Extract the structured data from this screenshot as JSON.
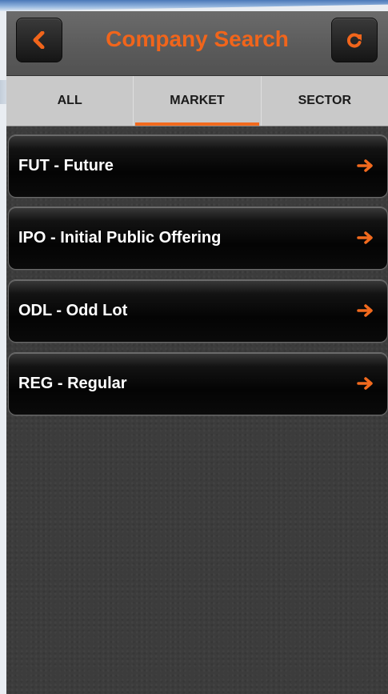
{
  "header": {
    "title": "Company Search",
    "back_icon": "chevron-left-icon",
    "refresh_icon": "refresh-icon"
  },
  "tabs": [
    {
      "label": "ALL",
      "active": false
    },
    {
      "label": "MARKET",
      "active": true
    },
    {
      "label": "SECTOR",
      "active": false
    }
  ],
  "markets": [
    {
      "label": "FUT - Future",
      "icon": "arrow-right-icon"
    },
    {
      "label": "IPO - Initial Public Offering",
      "icon": "arrow-right-icon"
    },
    {
      "label": "ODL - Odd Lot",
      "icon": "arrow-right-icon"
    },
    {
      "label": "REG - Regular",
      "icon": "arrow-right-icon"
    }
  ],
  "colors": {
    "accent": "#f1651b",
    "header_bg": "#5a5a5a",
    "tab_bg": "#c9c9c9",
    "content_bg": "#3c3c3c"
  }
}
